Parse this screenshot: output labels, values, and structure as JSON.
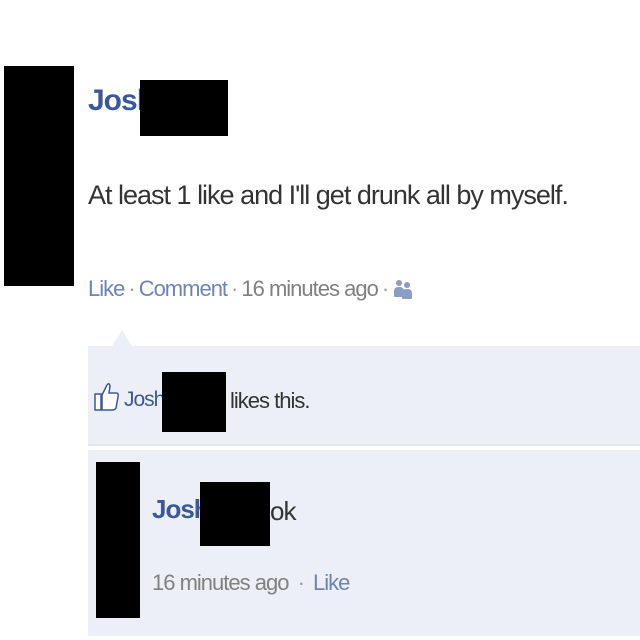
{
  "post": {
    "author": "Josh L",
    "body": "At least 1 like and I'll get drunk all by myself.",
    "actions": {
      "like": "Like",
      "comment": "Comment",
      "time": "16 minutes ago",
      "privacy_icon": "people-icon"
    }
  },
  "likes": {
    "icon": "thumbs-up-icon",
    "name": "Josh L",
    "text": "likes this."
  },
  "comment": {
    "author": "Josh L",
    "text": "ok",
    "time": "16 minutes ago",
    "like": "Like"
  },
  "colors": {
    "link": "#3b5998",
    "panel": "#eceff5",
    "muted": "#808080"
  }
}
